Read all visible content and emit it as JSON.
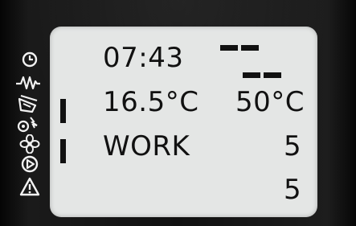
{
  "display": {
    "time": "07:43",
    "room_temperature": "16.5°C",
    "setpoint_temperature": "50°C",
    "mode": "WORK",
    "value_1": "5",
    "value_2": "5"
  },
  "icons": [
    {
      "name": "clock-icon"
    },
    {
      "name": "heartbeat-icon"
    },
    {
      "name": "fuel-icon"
    },
    {
      "name": "flame-fan-icon"
    },
    {
      "name": "fan-icon"
    },
    {
      "name": "play-icon"
    },
    {
      "name": "warning-icon"
    }
  ],
  "colors": {
    "screen_background": "#e4e6e5",
    "text": "#111111",
    "bezel": "#141414",
    "icon": "#f2f2f2"
  }
}
